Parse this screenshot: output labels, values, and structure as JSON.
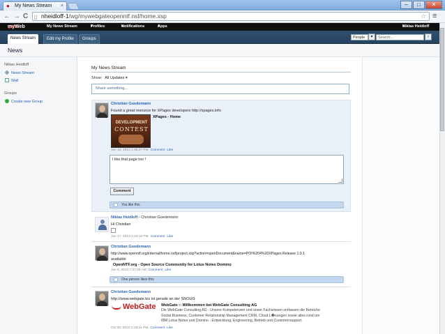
{
  "browser": {
    "tab_title": "My News Stream",
    "tab_close": "×",
    "window_min": "–",
    "window_max": "□",
    "window_close": "✕",
    "back": "←",
    "forward": "→",
    "reload": "C",
    "url_host": "nheidloff-1",
    "url_path": "/wg/mywebgateopenntf.nsf/home.xsp",
    "bookmark_star": "☆",
    "wrench": "≡"
  },
  "topbar": {
    "logo_main": "myWeb",
    "logo_accent": "gate",
    "items": [
      "My News Stream",
      "Profiles",
      "Notifications",
      "Apps"
    ],
    "user": "Niklas Heidloff"
  },
  "subbar": {
    "tabs": [
      "News Stream",
      "Edit my Profile",
      "Groups"
    ],
    "people_select": "People",
    "search_placeholder": "Search...",
    "search_button": "›"
  },
  "page": {
    "title": "News"
  },
  "sidebar": {
    "user_heading": "Niklas Heidloff",
    "user_links": [
      "News Stream",
      "Wall"
    ],
    "groups_heading": "Groups",
    "groups_links": [
      "Create new Group"
    ]
  },
  "main": {
    "title": "My News Stream",
    "show_label": "Show:",
    "show_value": "All Updates",
    "share_placeholder": "Share something..."
  },
  "posts": [
    {
      "author": "Christian Guedemann",
      "text": "Found a great resource for XPages developers http://xpages.info",
      "link_title": "XPages - Home",
      "thumb_line1": "DEVELOPMENT",
      "thumb_line2": "CONTEST",
      "meta_time": "Jan 19, 2013 1:56:27 PM",
      "meta_comment": "Comment",
      "meta_like": "Like",
      "comment_text": "I like that page too !",
      "comment_button": "Comment",
      "like_text": "You like this"
    },
    {
      "author": "Niklas Heidloff",
      "arrow": "›",
      "target": "Christian Guedemann",
      "text": "Hi Christian",
      "meta_time": "Jan 17, 2013 1:24:19 PM",
      "meta_comment": "Comment",
      "meta_like": "Like"
    },
    {
      "author": "Christian Guedemann",
      "text": "http://www.openntf.org/internal/home.nsf/project.xsp?action=openDocument&name=POI%204%20XPages Release 1.0.1",
      "text2": "available",
      "link_title": "OpenNTF.org - Open Source Community for Lotus Notes Domino",
      "meta_time": "Jan 8, 2013 7:37:49 AM",
      "meta_comment": "Comment",
      "meta_like": "Like",
      "like_text": "One person likes this"
    },
    {
      "author": "Christian Guedemann",
      "text": "http://www.webgate.biz ist gerade an der SNOUG",
      "logo_text": "Web",
      "logo_text2": "Gate",
      "link_title": "WebGate :: Willkommen bei WebGate Consulting AG",
      "desc_lines": [
        "Die WebGate Consulting AG - Unsere Kompetenzen und unser Fachwissen umfassen die Bereiche",
        "Social Business, Customer Relationship Management CRM, Cloud L�sungen sowie alles rund um",
        "IBM Lotus Notes und Domino - Entwicklung, Engineering, Betrieb und Customersupport."
      ],
      "meta_time": "Oct 30, 2012 1:18:31 PM",
      "meta_comment": "Comment",
      "meta_like": "Like"
    }
  ],
  "colors": {
    "link": "#2a64b6",
    "topbar": "#101010",
    "subbar": "#2f4f6f",
    "highlight": "#e9f0f8",
    "likebar": "#c3d7ee",
    "logo_red": "#c41e1e"
  },
  "icons": {
    "news_stream": "rss-icon",
    "wall": "wall-icon",
    "create_group": "add-icon",
    "like": "thumbs-up-icon"
  }
}
